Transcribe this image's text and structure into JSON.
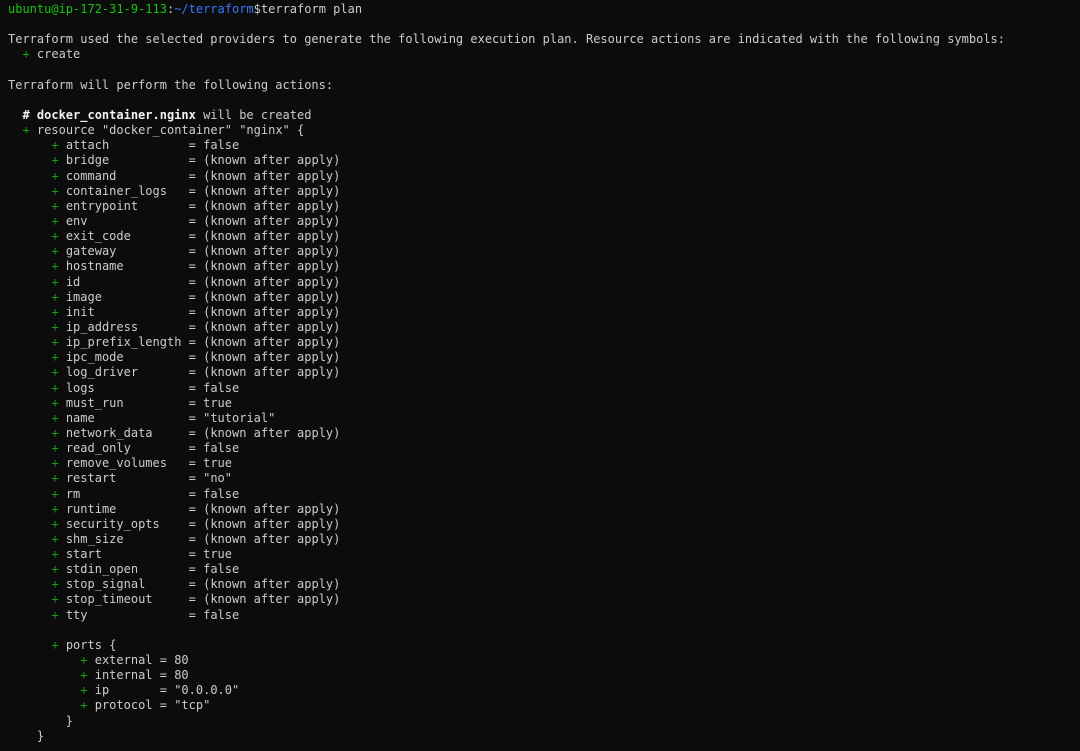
{
  "prompt": {
    "user_host": "ubuntu@ip-172-31-9-113",
    "path": "~/terraform",
    "symbol": "$",
    "command": "terraform plan"
  },
  "intro": "Terraform used the selected providers to generate the following execution plan. Resource actions are indicated with the following symbols:",
  "symbol_legend": {
    "symbol": "+",
    "label": "create"
  },
  "actions_heading": "Terraform will perform the following actions:",
  "resource": {
    "comment": "# docker_container.nginx",
    "comment_suffix": " will be created",
    "header": "resource \"docker_container\" \"nginx\" {",
    "attributes": [
      {
        "name": "attach",
        "value": "false"
      },
      {
        "name": "bridge",
        "value": "(known after apply)"
      },
      {
        "name": "command",
        "value": "(known after apply)"
      },
      {
        "name": "container_logs",
        "value": "(known after apply)"
      },
      {
        "name": "entrypoint",
        "value": "(known after apply)"
      },
      {
        "name": "env",
        "value": "(known after apply)"
      },
      {
        "name": "exit_code",
        "value": "(known after apply)"
      },
      {
        "name": "gateway",
        "value": "(known after apply)"
      },
      {
        "name": "hostname",
        "value": "(known after apply)"
      },
      {
        "name": "id",
        "value": "(known after apply)"
      },
      {
        "name": "image",
        "value": "(known after apply)"
      },
      {
        "name": "init",
        "value": "(known after apply)"
      },
      {
        "name": "ip_address",
        "value": "(known after apply)"
      },
      {
        "name": "ip_prefix_length",
        "value": "(known after apply)"
      },
      {
        "name": "ipc_mode",
        "value": "(known after apply)"
      },
      {
        "name": "log_driver",
        "value": "(known after apply)"
      },
      {
        "name": "logs",
        "value": "false"
      },
      {
        "name": "must_run",
        "value": "true"
      },
      {
        "name": "name",
        "value": "\"tutorial\""
      },
      {
        "name": "network_data",
        "value": "(known after apply)"
      },
      {
        "name": "read_only",
        "value": "false"
      },
      {
        "name": "remove_volumes",
        "value": "true"
      },
      {
        "name": "restart",
        "value": "\"no\""
      },
      {
        "name": "rm",
        "value": "false"
      },
      {
        "name": "runtime",
        "value": "(known after apply)"
      },
      {
        "name": "security_opts",
        "value": "(known after apply)"
      },
      {
        "name": "shm_size",
        "value": "(known after apply)"
      },
      {
        "name": "start",
        "value": "true"
      },
      {
        "name": "stdin_open",
        "value": "false"
      },
      {
        "name": "stop_signal",
        "value": "(known after apply)"
      },
      {
        "name": "stop_timeout",
        "value": "(known after apply)"
      },
      {
        "name": "tty",
        "value": "false"
      }
    ],
    "block": {
      "header": "ports {",
      "attributes": [
        {
          "name": "external",
          "value": "80"
        },
        {
          "name": "internal",
          "value": "80"
        },
        {
          "name": "ip",
          "value": "\"0.0.0.0\""
        },
        {
          "name": "protocol",
          "value": "\"tcp\""
        }
      ],
      "close": "}"
    },
    "close": "}"
  },
  "colors": {
    "background": "#0c0c0c",
    "text": "#cccccc",
    "prompt_user": "#16c60c",
    "prompt_path": "#3b78ff",
    "plus": "#13a10e"
  }
}
